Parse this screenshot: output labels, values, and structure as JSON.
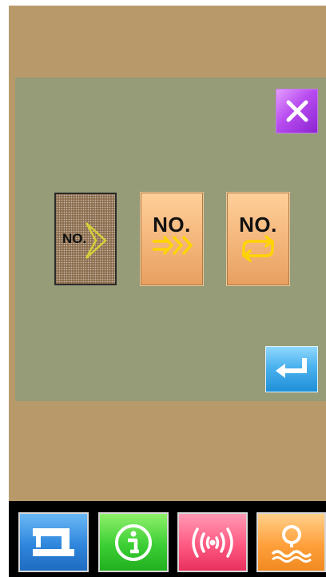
{
  "mode_buttons": [
    {
      "label": "NO.",
      "icon": "diamond-arrow-icon",
      "selected": true
    },
    {
      "label": "NO.",
      "icon": "double-arrow-right-icon",
      "selected": false
    },
    {
      "label": "NO.",
      "icon": "loop-arrows-icon",
      "selected": false
    }
  ],
  "actions": {
    "close_icon": "close-icon",
    "enter_icon": "enter-return-icon"
  },
  "nav": [
    {
      "icon": "sewing-machine-icon"
    },
    {
      "icon": "info-icon"
    },
    {
      "icon": "wireless-signal-icon"
    },
    {
      "icon": "search-wave-icon"
    }
  ],
  "colors": {
    "background": "#b89a6a",
    "panel": "#969b78",
    "close_button": "#b84cf0",
    "enter_button": "#4bb2ee",
    "mode_button": "#f3b57a",
    "arrow_yellow": "#ffd400",
    "nav_blue": "#2f86dc",
    "nav_green": "#3ccf35",
    "nav_red": "#ff5a82",
    "nav_orange": "#ffa03c"
  }
}
